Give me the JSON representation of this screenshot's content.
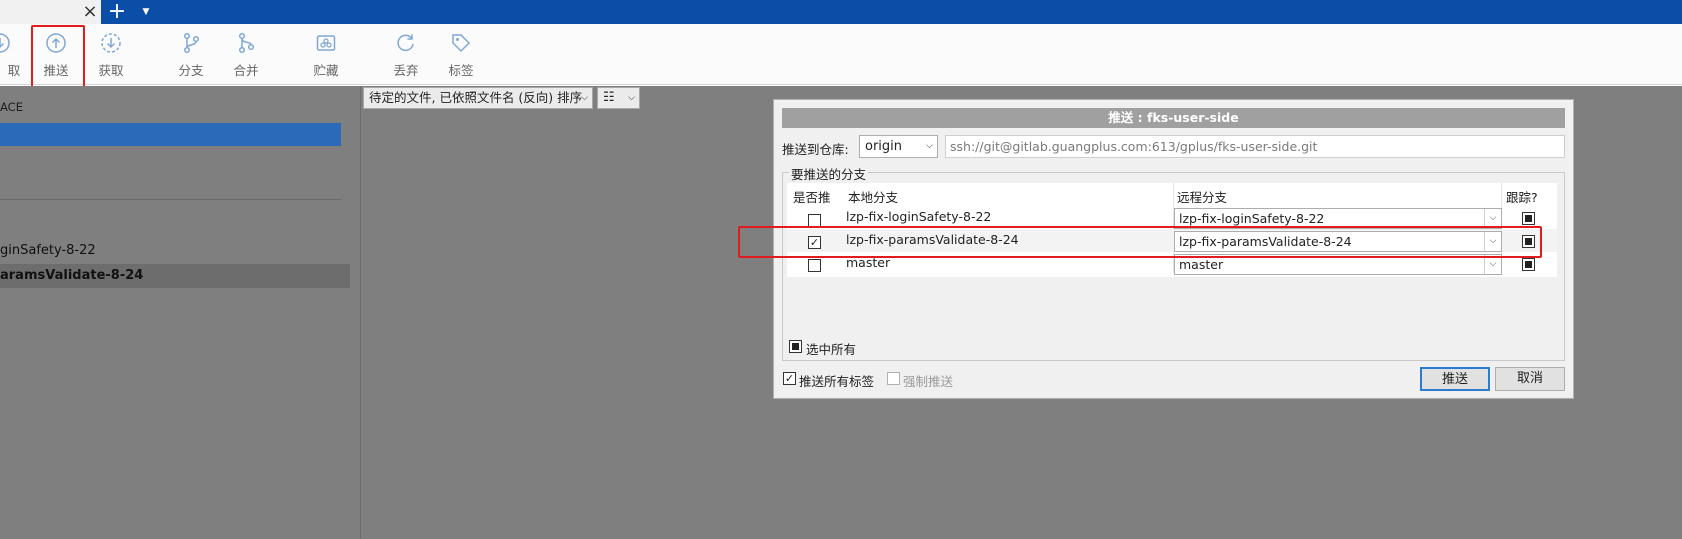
{
  "tab": {
    "close_icon": "×",
    "new_tab_icon": "+",
    "menu_icon": "▼"
  },
  "toolbar": {
    "items": [
      {
        "label": "取",
        "icon": "pull-icon"
      },
      {
        "label": "推送",
        "icon": "push-icon"
      },
      {
        "label": "获取",
        "icon": "fetch-icon"
      },
      {
        "label": "分支",
        "icon": "branch-icon"
      },
      {
        "label": "合并",
        "icon": "merge-icon"
      },
      {
        "label": "贮藏",
        "icon": "stash-icon"
      },
      {
        "label": "丢弃",
        "icon": "discard-icon"
      },
      {
        "label": "标签",
        "icon": "tag-icon"
      }
    ]
  },
  "left": {
    "workspace_label": "ACE",
    "branches": [
      "ginSafety-8-22",
      "aramsValidate-8-24"
    ]
  },
  "main": {
    "sort_label": "待定的文件, 已依照文件名 (反向) 排序",
    "view_label": "☷"
  },
  "dialog": {
    "title": "推送 : fks-user-side",
    "repo_label": "推送到仓库:",
    "repo_value": "origin",
    "repo_url": "ssh://git@gitlab.guangplus.com:613/gplus/fks-user-side.git",
    "group_label": "要推送的分支",
    "columns": {
      "push": "是否推",
      "local": "本地分支",
      "remote": "远程分支",
      "track": "跟踪?"
    },
    "rows": [
      {
        "local": "lzp-fix-loginSafety-8-22",
        "remote": "lzp-fix-loginSafety-8-22",
        "checked": false
      },
      {
        "local": "lzp-fix-paramsValidate-8-24",
        "remote": "lzp-fix-paramsValidate-8-24",
        "checked": true
      },
      {
        "local": "master",
        "remote": "master",
        "checked": false
      }
    ],
    "select_all": "选中所有",
    "push_all_tags": "推送所有标签",
    "force_push": "强制推送",
    "push_button": "推送",
    "cancel_button": "取消"
  },
  "colors": {
    "titlebar": "#0b4ea8",
    "highlight": "#e01c1c",
    "selection": "#2b6ab8"
  }
}
